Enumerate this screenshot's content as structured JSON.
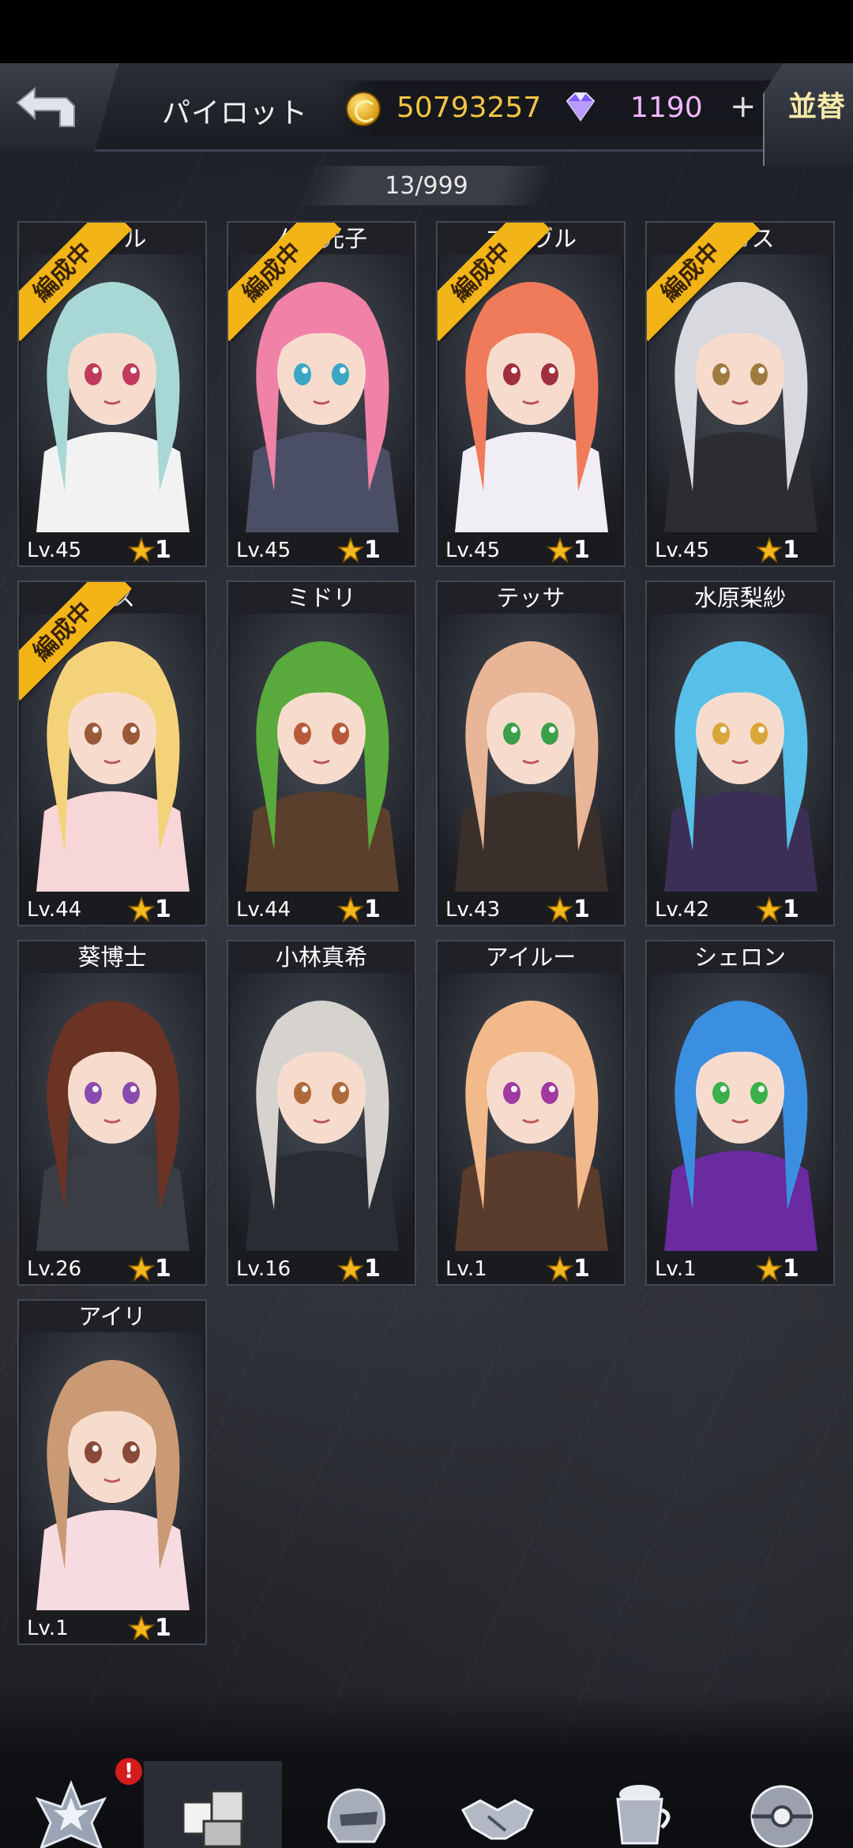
{
  "header": {
    "title": "パイロット",
    "coins": "50793257",
    "gems": "1190",
    "plus_label": "+",
    "sort_label": "並替",
    "count": "13/999"
  },
  "badge_label": "編成中",
  "pilots": [
    {
      "name": "マリル",
      "level": "Lv.45",
      "rank": "1",
      "in_team": true,
      "hair": "#a8d8d6",
      "outfit": "#f2f2f2",
      "eye": "#c23a5a"
    },
    {
      "name": "々木光子",
      "level": "Lv.45",
      "rank": "1",
      "in_team": true,
      "hair": "#ef82a6",
      "outfit": "#4b4f66",
      "eye": "#3aa6c4"
    },
    {
      "name": "エーヴル",
      "level": "Lv.45",
      "rank": "1",
      "in_team": true,
      "hair": "#f07b5a",
      "outfit": "#f0eef4",
      "eye": "#a03040"
    },
    {
      "name": "ーカス",
      "level": "Lv.45",
      "rank": "1",
      "in_team": true,
      "hair": "#d7d9df",
      "outfit": "#2c2d31",
      "eye": "#a07a40"
    },
    {
      "name": "リス",
      "level": "Lv.44",
      "rank": "1",
      "in_team": true,
      "hair": "#f4d27a",
      "outfit": "#f6d6d6",
      "eye": "#9a5a3a"
    },
    {
      "name": "ミドリ",
      "level": "Lv.44",
      "rank": "1",
      "in_team": false,
      "hair": "#5aa93c",
      "outfit": "#5a3f2c",
      "eye": "#b85a3a"
    },
    {
      "name": "テッサ",
      "level": "Lv.43",
      "rank": "1",
      "in_team": false,
      "hair": "#e8b596",
      "outfit": "#3a2f2a",
      "eye": "#3aa04a"
    },
    {
      "name": "水原梨紗",
      "level": "Lv.42",
      "rank": "1",
      "in_team": false,
      "hair": "#58c0e8",
      "outfit": "#3b2f56",
      "eye": "#d9a63a"
    },
    {
      "name": "葵博士",
      "level": "Lv.26",
      "rank": "1",
      "in_team": false,
      "hair": "#6a3324",
      "outfit": "#3b3d44",
      "eye": "#8a4ab0"
    },
    {
      "name": "小林真希",
      "level": "Lv.16",
      "rank": "1",
      "in_team": false,
      "hair": "#d6d3cf",
      "outfit": "#2a2c33",
      "eye": "#b06a3a"
    },
    {
      "name": "アイルー",
      "level": "Lv.1",
      "rank": "1",
      "in_team": false,
      "hair": "#f2b98a",
      "outfit": "#5a3c2c",
      "eye": "#a03aa0"
    },
    {
      "name": "シェロン",
      "level": "Lv.1",
      "rank": "1",
      "in_team": false,
      "hair": "#3b8fe0",
      "outfit": "#6a2aa0",
      "eye": "#3ab04a"
    },
    {
      "name": "アイリ",
      "level": "Lv.1",
      "rank": "1",
      "in_team": false,
      "hair": "#c99a74",
      "outfit": "#f6dbe0",
      "eye": "#8a4a3a"
    }
  ],
  "nav": [
    {
      "label": "基地",
      "icon": "base-emblem-icon",
      "active": false,
      "alert": "!"
    },
    {
      "label": "格納庫",
      "icon": "hangar-cube-icon",
      "active": true
    },
    {
      "label": "編成",
      "icon": "formation-helmet-icon",
      "active": false
    },
    {
      "label": "フレンド",
      "icon": "handshake-icon",
      "active": false
    },
    {
      "label": "喫茶店",
      "icon": "cafe-cup-icon",
      "active": false
    },
    {
      "label": "ショップ",
      "icon": "shop-capsule-icon",
      "active": false
    }
  ]
}
